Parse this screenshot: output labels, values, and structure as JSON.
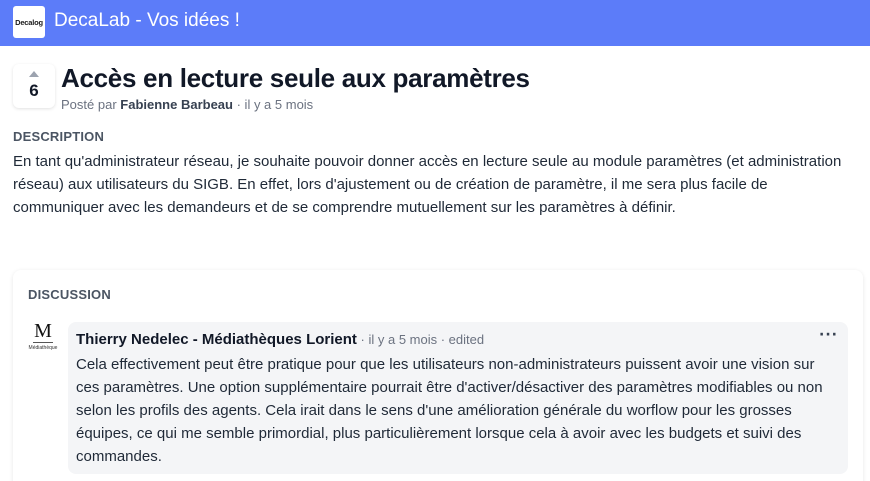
{
  "app": {
    "logo_text": "Decalog",
    "title": "DecaLab - Vos idées !"
  },
  "post": {
    "votes": "6",
    "title": "Accès en lecture seule aux paramètres",
    "posted_by_prefix": "Posté par",
    "author": "Fabienne Barbeau",
    "time": "· il y a 5 mois",
    "description_label": "DESCRIPTION",
    "description": "En tant qu'administrateur réseau, je souhaite pouvoir donner accès en lecture seule au module paramètres (et administration réseau) aux utilisateurs du SIGB. En effet, lors d'ajustement ou de création de paramètre, il me sera plus facile de communiquer avec les demandeurs et de se comprendre mutuellement sur les paramètres à définir."
  },
  "discussion": {
    "label": "DISCUSSION",
    "comments": [
      {
        "avatar_mark": "M",
        "avatar_caption": "Médiathèque",
        "author": "Thierry Nedelec - Médiathèques Lorient",
        "meta": "· il y a 5 mois · edited",
        "menu": "···",
        "text": "Cela effectivement peut être pratique pour que les utilisateurs non-administrateurs puissent avoir une vision sur ces paramètres. Une option supplémentaire pourrait être d'activer/désactiver des paramètres modifiables ou non selon les profils des agents. Cela irait dans le sens d'une amélioration générale du worflow pour les grosses équipes, ce qui me semble primordial, plus particulièrement lorsque cela à avoir avec les budgets et suivi des commandes."
      }
    ]
  },
  "colors": {
    "topbar": "#5c7cf9",
    "comment_bg": "#f4f5f7"
  }
}
